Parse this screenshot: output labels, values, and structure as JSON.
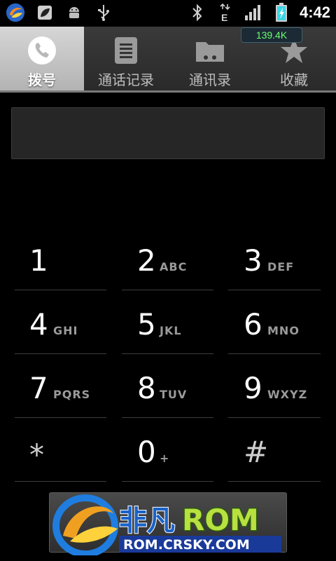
{
  "statusbar": {
    "time": "4:42",
    "icons_left": [
      "app-logo-icon",
      "leaf-icon",
      "android-icon",
      "usb-icon"
    ],
    "icons_right": [
      "bluetooth-icon",
      "edge-data-icon",
      "signal-icon",
      "battery-charging-icon"
    ]
  },
  "net_speed": "139.4K",
  "tabs": [
    {
      "label": "拨号",
      "icon": "phone-icon",
      "active": true
    },
    {
      "label": "通话记录",
      "icon": "call-log-icon",
      "active": false
    },
    {
      "label": "通讯录",
      "icon": "contacts-icon",
      "active": false
    },
    {
      "label": "收藏",
      "icon": "star-icon",
      "active": false
    }
  ],
  "digits_value": "",
  "keypad": [
    [
      {
        "digit": "1",
        "letters": ""
      },
      {
        "digit": "2",
        "letters": "ABC"
      },
      {
        "digit": "3",
        "letters": "DEF"
      }
    ],
    [
      {
        "digit": "4",
        "letters": "GHI"
      },
      {
        "digit": "5",
        "letters": "JKL"
      },
      {
        "digit": "6",
        "letters": "MNO"
      }
    ],
    [
      {
        "digit": "7",
        "letters": "PQRS"
      },
      {
        "digit": "8",
        "letters": "TUV"
      },
      {
        "digit": "9",
        "letters": "WXYZ"
      }
    ],
    [
      {
        "digit": "*",
        "letters": ""
      },
      {
        "digit": "0",
        "letters": "+"
      },
      {
        "digit": "#",
        "letters": ""
      }
    ]
  ],
  "watermark": {
    "brand_cn": "非凡",
    "brand_en": "ROM",
    "site": "ROM.CRSKY.COM"
  },
  "colors": {
    "active_tab": "#c4c4c4",
    "tab_bar": "#333333",
    "net_speed_text": "#6cff6c",
    "battery": "#3bd5e6"
  }
}
